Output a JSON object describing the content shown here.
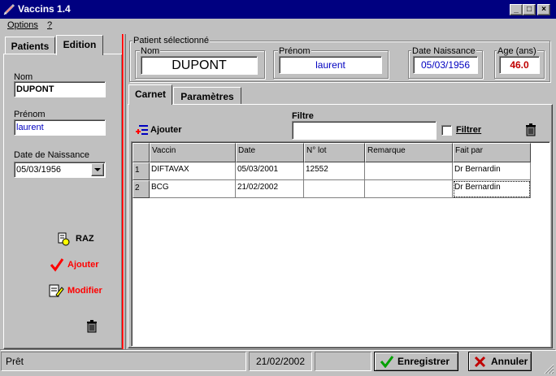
{
  "window": {
    "title": "Vaccins 1.4"
  },
  "menu": {
    "items": [
      "Options",
      "?"
    ]
  },
  "left": {
    "tabs": [
      {
        "label": "Patients"
      },
      {
        "label": "Edition"
      }
    ],
    "nom_label": "Nom",
    "nom_value": "DUPONT",
    "prenom_label": "Prénom",
    "prenom_value": "laurent",
    "dob_label": "Date de Naissance",
    "dob_value": "05/03/1956",
    "raz_label": "RAZ",
    "ajouter_label": "Ajouter",
    "modifier_label": "Modifier"
  },
  "patient": {
    "group_label": "Patient sélectionné",
    "nom_label": "Nom",
    "nom_value": "DUPONT",
    "prenom_label": "Prénom",
    "prenom_value": "laurent",
    "dob_label": "Date Naissance",
    "dob_value": "05/03/1956",
    "age_label": "Age (ans)",
    "age_value": "46.0"
  },
  "main": {
    "tabs": [
      {
        "label": "Carnet"
      },
      {
        "label": "Paramètres"
      }
    ],
    "ajouter_label": "Ajouter",
    "filtre_label": "Filtre",
    "filtre_value": "",
    "filtrer_label": "Filtrer"
  },
  "grid": {
    "columns": [
      "Vaccin",
      "Date",
      "N° lot",
      "Remarque",
      "Fait par"
    ],
    "rows": [
      {
        "num": "1",
        "vaccin": "DIFTAVAX",
        "date": "05/03/2001",
        "lot": "12552",
        "remarque": "",
        "fait_par": "Dr Bernardin"
      },
      {
        "num": "2",
        "vaccin": "BCG",
        "date": "21/02/2002",
        "lot": "",
        "remarque": "",
        "fait_par": "Dr Bernardin"
      }
    ]
  },
  "status": {
    "text": "Prêt",
    "date": "21/02/2002",
    "enregistrer_label": "Enregistrer",
    "annuler_label": "Annuler"
  },
  "colors": {
    "title_bar": "#000080",
    "accent_red": "#ff0000",
    "value_blue": "#0000c0",
    "age_red": "#c00000"
  }
}
